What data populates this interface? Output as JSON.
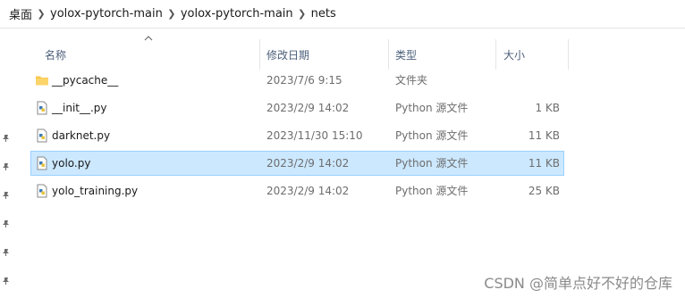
{
  "breadcrumb": {
    "items": [
      "桌面",
      "yolox-pytorch-main",
      "yolox-pytorch-main",
      "nets"
    ]
  },
  "columns": {
    "name": "名称",
    "date": "修改日期",
    "type": "类型",
    "size": "大小"
  },
  "files": [
    {
      "name": "__pycache__",
      "date": "2023/7/6 9:15",
      "type": "文件夹",
      "size": "",
      "icon": "folder-icon",
      "selected": false
    },
    {
      "name": "__init__.py",
      "date": "2023/2/9 14:02",
      "type": "Python 源文件",
      "size": "1 KB",
      "icon": "python-file-icon",
      "selected": false
    },
    {
      "name": "darknet.py",
      "date": "2023/11/30 15:10",
      "type": "Python 源文件",
      "size": "11 KB",
      "icon": "python-file-icon",
      "selected": false
    },
    {
      "name": "yolo.py",
      "date": "2023/2/9 14:02",
      "type": "Python 源文件",
      "size": "11 KB",
      "icon": "python-file-icon",
      "selected": true
    },
    {
      "name": "yolo_training.py",
      "date": "2023/2/9 14:02",
      "type": "Python 源文件",
      "size": "25 KB",
      "icon": "python-file-icon",
      "selected": false
    }
  ],
  "watermark": "CSDN @简单点好不好的仓库",
  "colors": {
    "selection_bg": "#cce8ff",
    "selection_border": "#99d1ff",
    "header_text": "#4c607a",
    "folder": "#f8c94d"
  }
}
